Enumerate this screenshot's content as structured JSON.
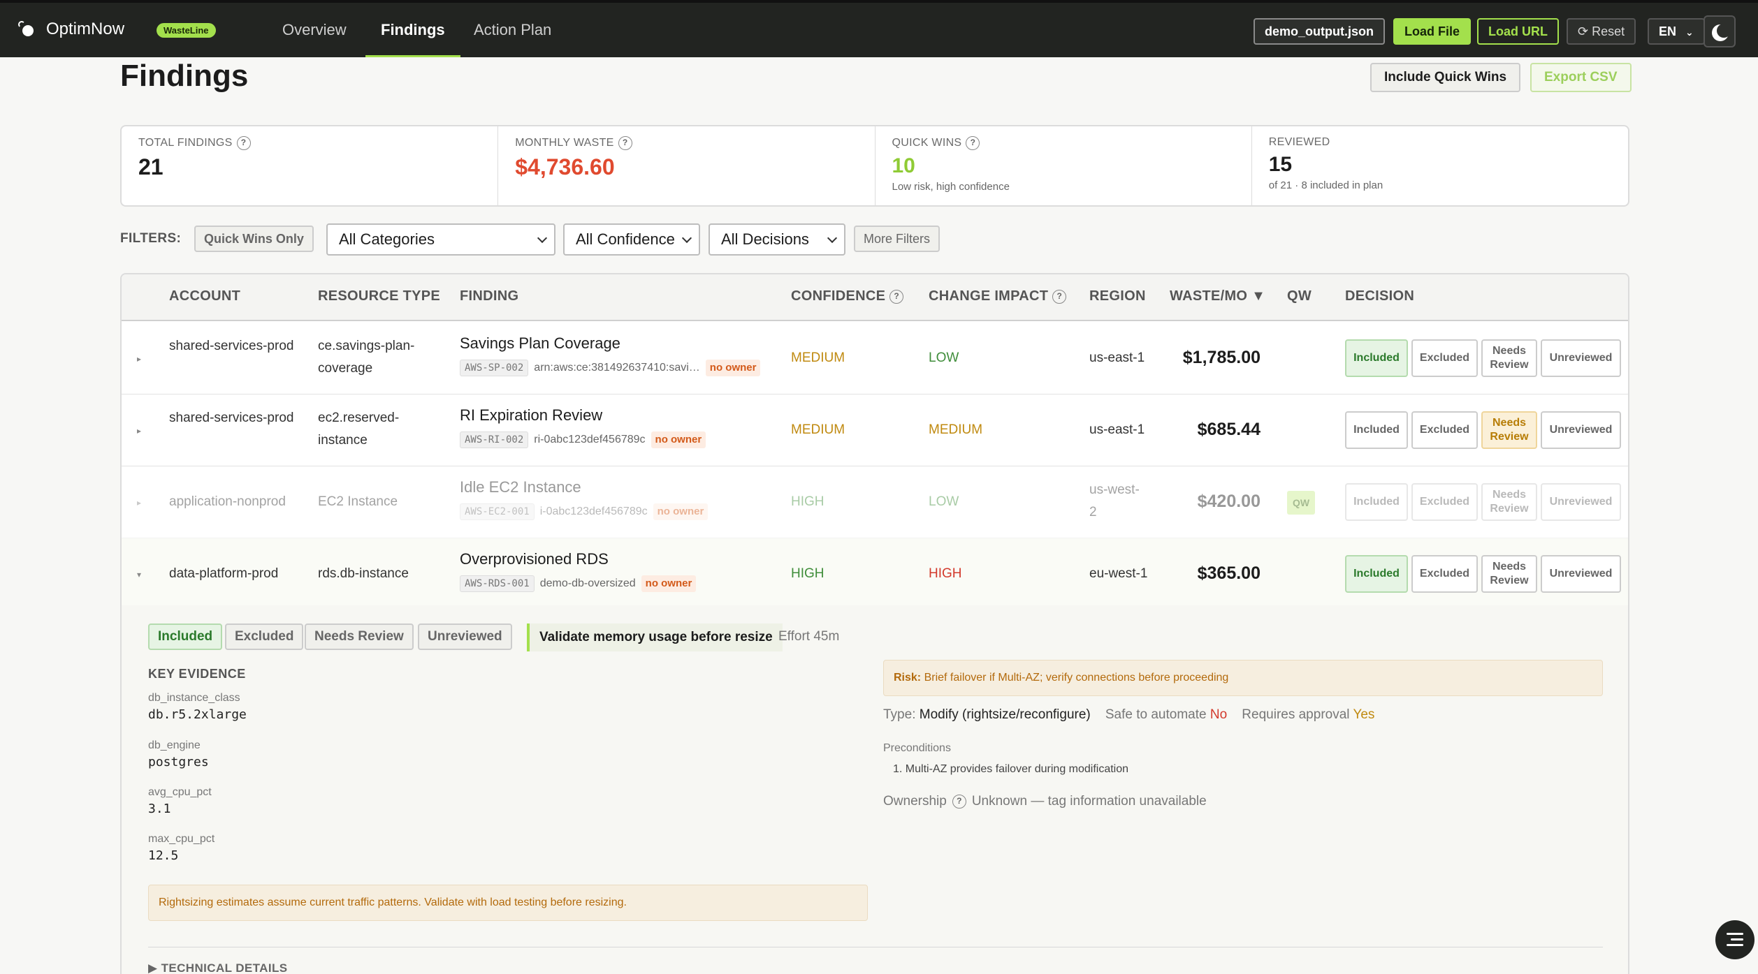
{
  "app": {
    "name": "OptimNow",
    "badge": "WasteLine"
  },
  "nav": {
    "tabs": [
      "Overview",
      "Findings",
      "Action Plan"
    ],
    "active": "Findings"
  },
  "toolbar": {
    "file_label": "demo_output.json",
    "load_file": "Load File",
    "load_url": "Load URL",
    "reset": "Reset",
    "lang": "EN"
  },
  "page": {
    "title": "Findings",
    "include_quick_wins": "Include Quick Wins",
    "export_csv": "Export CSV"
  },
  "stats": {
    "total": {
      "label": "TOTAL FINDINGS",
      "value": "21"
    },
    "waste": {
      "label": "MONTHLY WASTE",
      "value": "$4,736.60"
    },
    "quick": {
      "label": "QUICK WINS",
      "value": "10",
      "sub": "Low risk, high confidence"
    },
    "reviewed": {
      "label": "REVIEWED",
      "value": "15",
      "sub": "of 21 · 8 included in plan"
    }
  },
  "filters": {
    "label": "FILTERS:",
    "quick_wins_only": "Quick Wins Only",
    "categories": "All Categories",
    "confidence": "All Confidence",
    "decisions": "All Decisions",
    "more": "More Filters"
  },
  "table": {
    "headers": {
      "account": "ACCOUNT",
      "resource_type": "RESOURCE TYPE",
      "finding": "FINDING",
      "confidence": "CONFIDENCE",
      "change_impact": "CHANGE IMPACT",
      "region": "REGION",
      "waste": "WASTE/MO ▼",
      "qw": "QW",
      "decision": "DECISION"
    },
    "decision_labels": {
      "included": "Included",
      "excluded": "Excluded",
      "needs_review": "Needs Review",
      "unreviewed": "Unreviewed"
    },
    "no_owner": "no owner",
    "rows": [
      {
        "account": "shared-services-prod",
        "resource_type": "ce.savings-plan-coverage",
        "title": "Savings Plan Coverage",
        "code": "AWS-SP-002",
        "resource": "arn:aws:ce:381492637410:savi…",
        "confidence": "MEDIUM",
        "impact": "LOW",
        "region": "us-east-1",
        "waste": "$1,785.00",
        "qw": "",
        "decision": "included"
      },
      {
        "account": "shared-services-prod",
        "resource_type": "ec2.reserved-instance",
        "title": "RI Expiration Review",
        "code": "AWS-RI-002",
        "resource": "ri-0abc123def456789c",
        "confidence": "MEDIUM",
        "impact": "MEDIUM",
        "region": "us-east-1",
        "waste": "$685.44",
        "qw": "",
        "decision": "needs_review"
      },
      {
        "account": "application-nonprod",
        "resource_type": "EC2 Instance",
        "title": "Idle EC2 Instance",
        "code": "AWS-EC2-001",
        "resource": "i-0abc123def456789c",
        "confidence": "HIGH",
        "impact": "LOW",
        "region": "us-west-2",
        "waste": "$420.00",
        "qw": "QW",
        "decision": "none"
      },
      {
        "account": "data-platform-prod",
        "resource_type": "rds.db-instance",
        "title": "Overprovisioned RDS",
        "code": "AWS-RDS-001",
        "resource": "demo-db-oversized",
        "confidence": "HIGH",
        "impact": "HIGH",
        "region": "eu-west-1",
        "waste": "$365.00",
        "qw": "",
        "decision": "included"
      }
    ]
  },
  "detail": {
    "decisions": [
      "Included",
      "Excluded",
      "Needs Review",
      "Unreviewed"
    ],
    "plan_tag": "Validate memory usage before resize",
    "effort": "Effort 45m",
    "evidence_heading": "KEY EVIDENCE",
    "evidence": [
      {
        "key": "db_instance_class",
        "value": "db.r5.2xlarge"
      },
      {
        "key": "db_engine",
        "value": "postgres"
      },
      {
        "key": "avg_cpu_pct",
        "value": "3.1"
      },
      {
        "key": "max_cpu_pct",
        "value": "12.5"
      }
    ],
    "note": "Rightsizing estimates assume current traffic patterns. Validate with load testing before resizing.",
    "risk_label": "Risk:",
    "risk": "Brief failover if Multi-AZ; verify connections before proceeding",
    "type_label": "Type:",
    "type_value": "Modify (rightsize/reconfigure)",
    "safe_label": "Safe to automate",
    "safe_value": "No",
    "approval_label": "Requires approval",
    "approval_value": "Yes",
    "preconditions_label": "Preconditions",
    "precondition_1": "1. Multi-AZ provides failover during modification",
    "ownership_label": "Ownership",
    "ownership_value": "Unknown — tag information unavailable",
    "technical_details": "TECHNICAL DETAILS"
  },
  "colors": {
    "accent": "#a3e04c",
    "topbar": "#222421",
    "waste_red": "#e04a2f"
  }
}
